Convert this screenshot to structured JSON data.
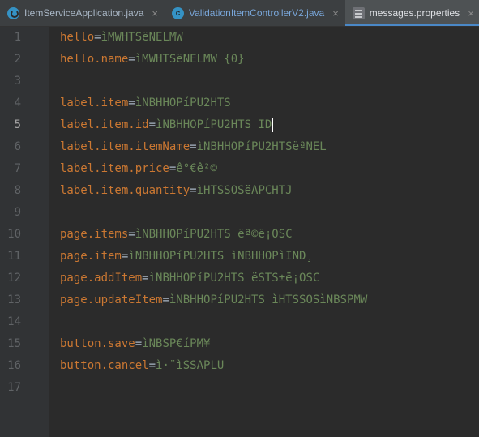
{
  "tabs": [
    {
      "label": "ItemServiceApplication.java",
      "icon": "spring-icon",
      "active": false
    },
    {
      "label": "ValidationItemControllerV2.java",
      "icon": "class-icon",
      "active": false
    },
    {
      "label": "messages.properties",
      "icon": "properties-file-icon",
      "active": true
    }
  ],
  "close_glyph": "×",
  "class_icon_letter": "c",
  "current_line": 5,
  "lines": [
    {
      "num": "1",
      "key": "hello",
      "eq": "=",
      "val": "ìMWHTSëNELMW"
    },
    {
      "num": "2",
      "key": "hello.name",
      "eq": "=",
      "val": "ìMWHTSëNELMW {0}"
    },
    {
      "num": "3",
      "key": "",
      "eq": "",
      "val": ""
    },
    {
      "num": "4",
      "key": "label.item",
      "eq": "=",
      "val": "ìNBHHOPíPU2HTS"
    },
    {
      "num": "5",
      "key": "label.item.id",
      "eq": "=",
      "val": "ìNBHHOPíPU2HTS ID"
    },
    {
      "num": "6",
      "key": "label.item.itemName",
      "eq": "=",
      "val": "ìNBHHOPíPU2HTSëªNEL"
    },
    {
      "num": "7",
      "key": "label.item.price",
      "eq": "=",
      "val": "ê°€ê²©"
    },
    {
      "num": "8",
      "key": "label.item.quantity",
      "eq": "=",
      "val": "ìHTSSOSëAPCHTJ"
    },
    {
      "num": "9",
      "key": "",
      "eq": "",
      "val": ""
    },
    {
      "num": "10",
      "key": "page.items",
      "eq": "=",
      "val": "ìNBHHOPíPU2HTS ëª©ë¡OSC"
    },
    {
      "num": "11",
      "key": "page.item",
      "eq": "=",
      "val": "ìNBHHOPíPU2HTS ìNBHHOPìIND¸"
    },
    {
      "num": "12",
      "key": "page.addItem",
      "eq": "=",
      "val": "ìNBHHOPíPU2HTS ëSTS±ë¡OSC"
    },
    {
      "num": "13",
      "key": "page.updateItem",
      "eq": "=",
      "val": "ìNBHHOPíPU2HTS ìHTSSOSìNBSPMW"
    },
    {
      "num": "14",
      "key": "",
      "eq": "",
      "val": ""
    },
    {
      "num": "15",
      "key": "button.save",
      "eq": "=",
      "val": "ìNBSP€íPM¥"
    },
    {
      "num": "16",
      "key": "button.cancel",
      "eq": "=",
      "val": "ì·¨ìSSAPLU"
    },
    {
      "num": "17",
      "key": "",
      "eq": "",
      "val": ""
    }
  ],
  "colors": {
    "key": "#cc7832",
    "value": "#6a8759",
    "background": "#2b2b2b",
    "tab_accent": "#4a88c7"
  }
}
